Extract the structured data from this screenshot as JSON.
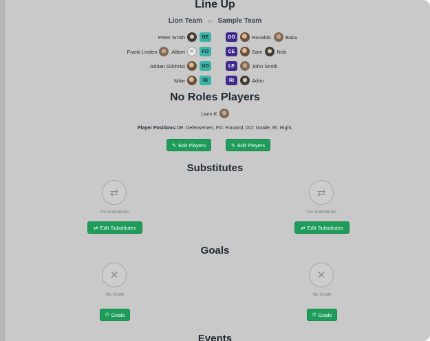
{
  "lineup": {
    "title": "Line Up",
    "team_left": "Lion Team",
    "vs": "vs",
    "team_right": "Sample Team",
    "rows": [
      {
        "left_name": "Peter Smith",
        "left_pos": "DE",
        "right_pos": "GO",
        "right_players": [
          "Ronaldo",
          "Babu"
        ]
      },
      {
        "left_names": [
          "Frank Linden",
          "Albert"
        ],
        "left_pos": "FO",
        "right_pos": "CE",
        "right_players": [
          "Sam",
          "Nob"
        ]
      },
      {
        "left_name": "Adrian Gilchrist",
        "left_pos": "GO",
        "right_pos": "LE",
        "right_players": [
          "John Smith"
        ]
      },
      {
        "left_name": "Mike",
        "left_pos": "RI",
        "right_pos": "RI",
        "right_players": [
          "Adrin"
        ]
      }
    ],
    "albert_initials": "AL"
  },
  "no_roles": {
    "title": "No Roles Players",
    "player": "Liam K",
    "positions_label": "Player Positions:",
    "positions_text": "DE: Defensemen, FO: Forward, GO: Goalie, RI: Right,"
  },
  "buttons": {
    "edit_players": "Edit Players",
    "edit_substitutes": "Edit Substitutes",
    "goals": "Goals"
  },
  "substitutes": {
    "title": "Substitutes",
    "empty": "No Substitutes"
  },
  "goals": {
    "title": "Goals",
    "empty": "No Goals"
  },
  "events": {
    "title": "Events"
  },
  "colors": {
    "accent": "#1e9c5a",
    "team_left_badge": "#3bb3a7",
    "team_right_badge": "#3f2a8c",
    "backdrop": "#c9c9c9"
  }
}
